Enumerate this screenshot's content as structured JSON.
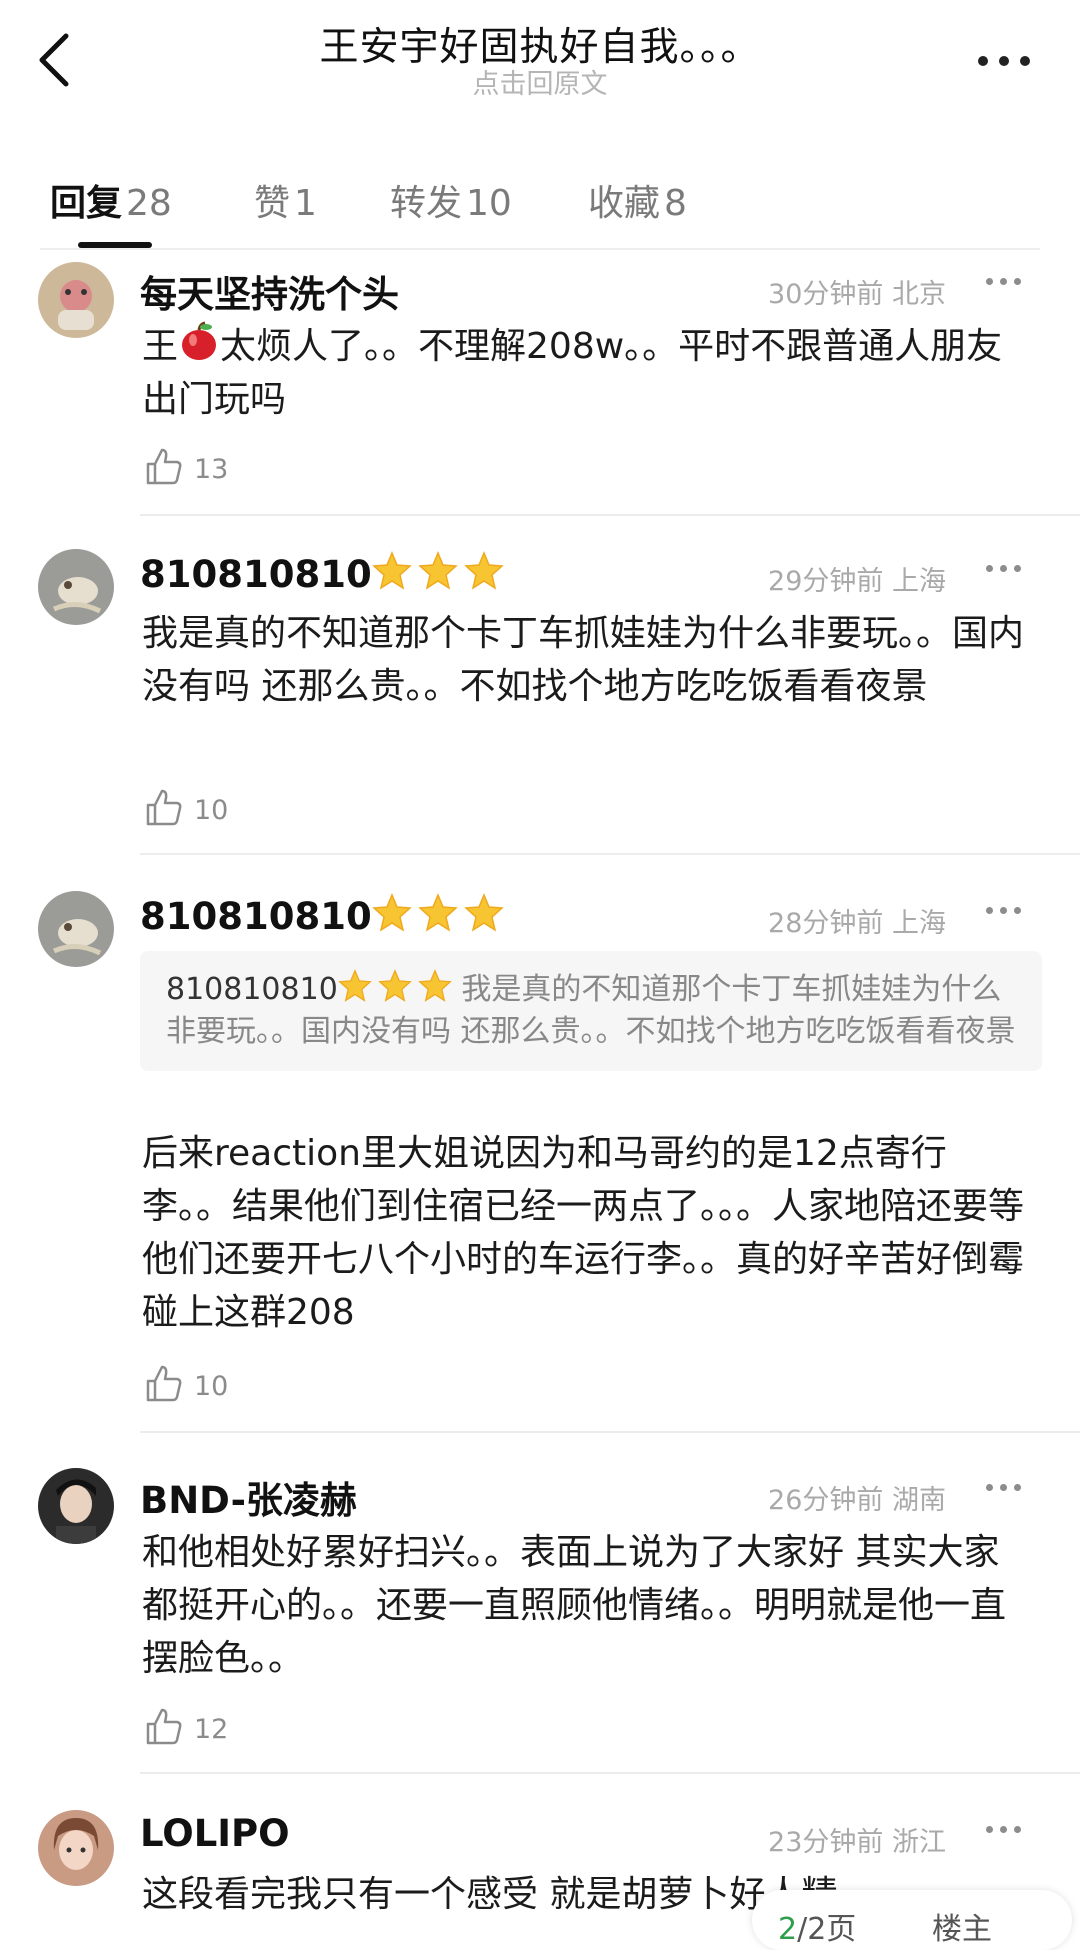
{
  "header": {
    "title": "王安宇好固执好自我。。。",
    "subtitle": "点击回原文"
  },
  "tabs": [
    {
      "label": "回复",
      "count": "28"
    },
    {
      "label": "赞",
      "count": "1"
    },
    {
      "label": "转发",
      "count": "10"
    },
    {
      "label": "收藏",
      "count": "8"
    }
  ],
  "comments": [
    {
      "name": "每天坚持洗个头",
      "time": "30分钟前",
      "location": "北京",
      "text_before_emoji": "王",
      "emoji": "apple",
      "text_after_emoji": "太烦人了。。不理解208w。。平时不跟普通人朋友出门玩吗",
      "likes": "13"
    },
    {
      "name": "810810810",
      "time": "29分钟前",
      "location": "上海",
      "text": "我是真的不知道那个卡丁车抓娃娃为什么非要玩。。国内没有吗 还那么贵。。不如找个地方吃吃饭看看夜景",
      "likes": "10"
    },
    {
      "name": "810810810",
      "time": "28分钟前",
      "location": "上海",
      "quote_name": "810810810",
      "quote_text": "我是真的不知道那个卡丁车抓娃娃为什么非要玩。。国内没有吗 还那么贵。。不如找个地方吃吃饭看看夜景",
      "text": "后来reaction里大姐说因为和马哥约的是12点寄行李。。结果他们到住宿已经一两点了。。。人家地陪还要等他们还要开七八个小时的车运行李。。真的好辛苦好倒霉碰上这群208",
      "likes": "10"
    },
    {
      "name": "BND-张凌赫",
      "time": "26分钟前",
      "location": "湖南",
      "text": "和他相处好累好扫兴。。表面上说为了大家好 其实大家都挺开心的。。还要一直照顾他情绪。。明明就是他一直摆脸色。。",
      "likes": "12"
    },
    {
      "name": "LOLIPO",
      "time": "23分钟前",
      "location": "浙江",
      "text": "这段看完我只有一个感受 就是胡萝卜好人精"
    }
  ],
  "pager": {
    "current": "2",
    "total": "/2页",
    "floor": "楼主"
  },
  "colors": {
    "accent_green": "#2f9e4b",
    "meta_gray": "#a9a9a9",
    "star_gold": "#f7c531"
  },
  "icons": [
    "back-arrow-icon",
    "more-icon",
    "thumb-up-icon",
    "star-badge-icon",
    "apple-emoji-icon"
  ]
}
